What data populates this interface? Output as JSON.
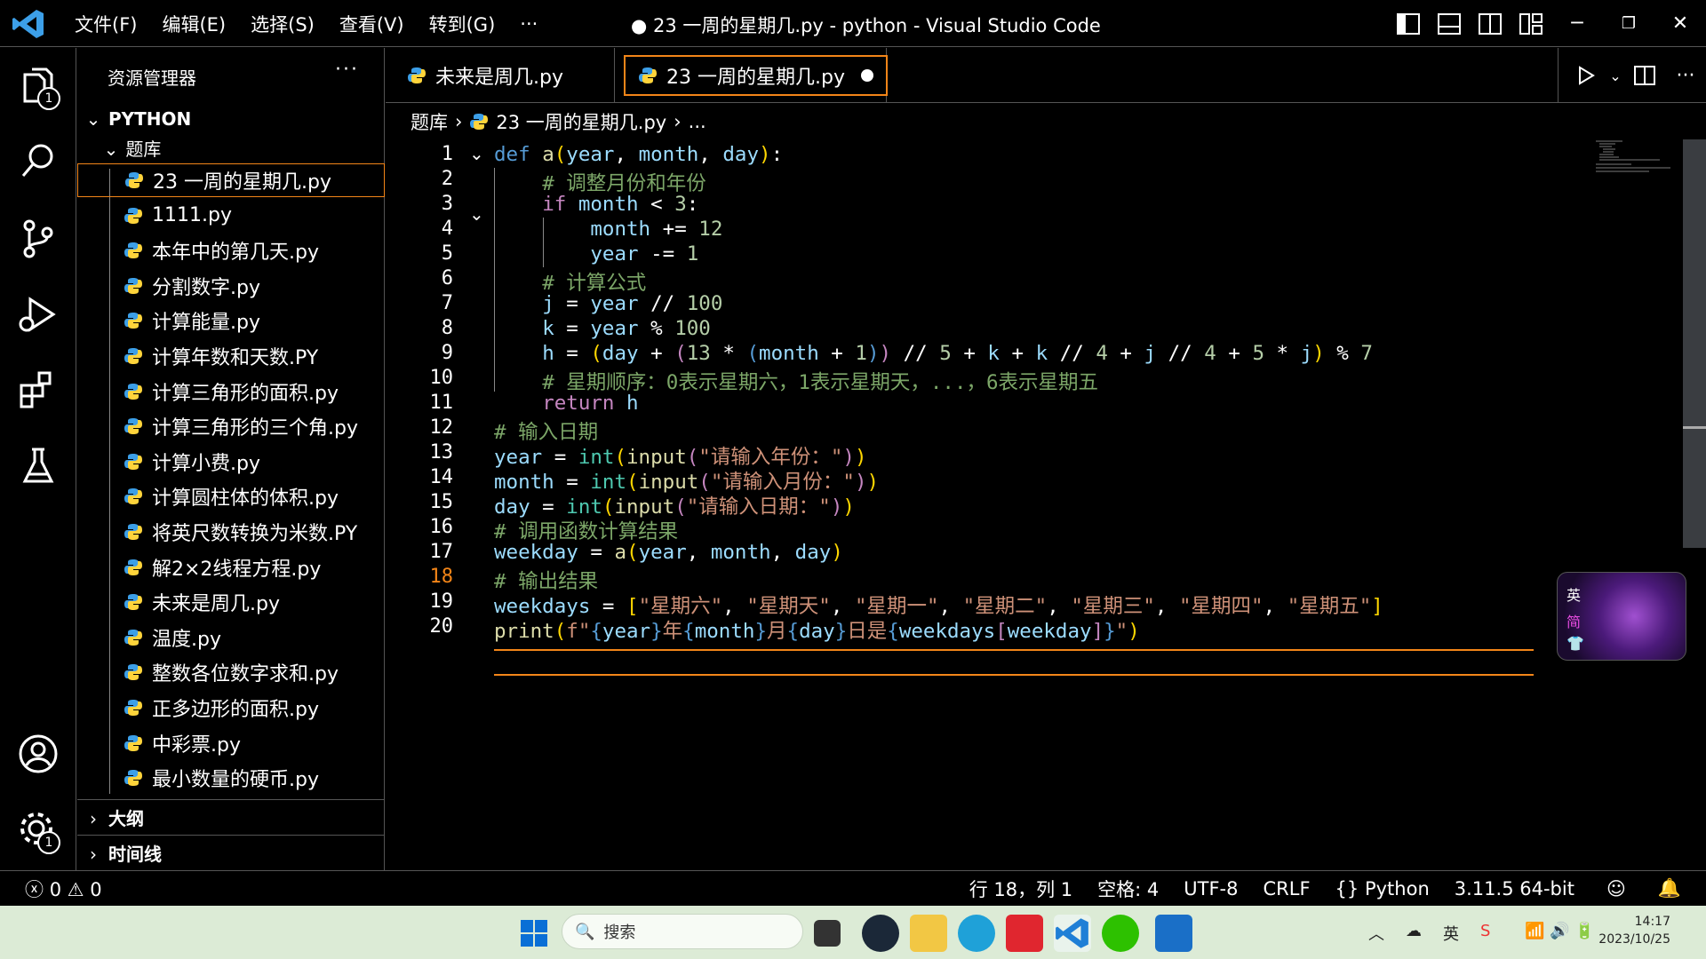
{
  "menu": [
    "文件(F)",
    "编辑(E)",
    "选择(S)",
    "查看(V)",
    "转到(G)",
    "···"
  ],
  "window_title": "● 23 一周的星期几.py - python - Visual Studio Code",
  "explorer": {
    "title": "资源管理器",
    "more": "···",
    "root": "PYTHON",
    "folder": "题库",
    "files": [
      "23 一周的星期几.py",
      "1111.py",
      "本年中的第几天.py",
      "分割数字.py",
      "计算能量.py",
      "计算年数和天数.PY",
      "计算三角形的面积.py",
      "计算三角形的三个角.py",
      "计算小费.py",
      "计算圆柱体的体积.py",
      "将英尺数转换为米数.PY",
      "解2×2线程方程.py",
      "未来是周几.py",
      "温度.py",
      "整数各位数字求和.py",
      "正多边形的面积.py",
      "中彩票.py",
      "最小数量的硬币.py"
    ],
    "outline": "大纲",
    "timeline": "时间线"
  },
  "activity_badges": {
    "explorer": "1",
    "settings": "1"
  },
  "tabs": [
    {
      "label": "未来是周几.py"
    },
    {
      "label": "23 一周的星期几.py"
    }
  ],
  "breadcrumb": {
    "folder": "题库",
    "file": "23 一周的星期几.py",
    "rest": "..."
  },
  "line_numbers": [
    "1",
    "2",
    "3",
    "4",
    "5",
    "6",
    "7",
    "8",
    "9",
    "10",
    "11",
    "12",
    "13",
    "14",
    "15",
    "16",
    "17",
    "18",
    "19",
    "20"
  ],
  "ime": {
    "lang": "英",
    "mode": "简"
  },
  "status": {
    "errors": "0",
    "warnings": "0",
    "position": "行 18，列 1",
    "spaces": "空格: 4",
    "encoding": "UTF-8",
    "eol": "CRLF",
    "language": "Python",
    "interpreter": "3.11.5 64-bit"
  },
  "taskbar": {
    "search_placeholder": "搜索",
    "time": "14:17",
    "date": "2023/10/25",
    "ime_tray": "英"
  },
  "colors": {
    "accent": "#f38518",
    "keyword": "#569cd6",
    "comment": "#7ca668",
    "string": "#ce9178"
  }
}
